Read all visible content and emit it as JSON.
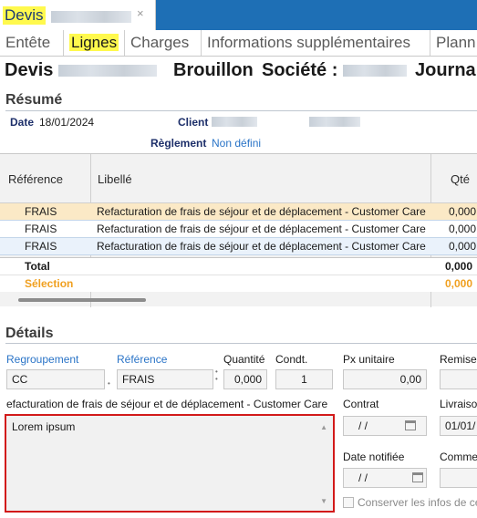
{
  "window": {
    "tab_title": "Devis",
    "close_glyph": "×"
  },
  "tabs": [
    {
      "label": "Entête"
    },
    {
      "label": "Lignes"
    },
    {
      "label": "Charges"
    },
    {
      "label": "Informations supplémentaires"
    },
    {
      "label": "Plann"
    }
  ],
  "header": {
    "prefix": "Devis",
    "status": "Brouillon",
    "societe_label": "Société :",
    "journal_label": "Journal"
  },
  "resume": {
    "title": "Résumé",
    "date_label": "Date",
    "date_value": "18/01/2024",
    "client_label": "Client",
    "reglement_label": "Règlement",
    "reglement_value": "Non défini"
  },
  "grid": {
    "columns": [
      "Référence",
      "Libellé",
      "Qté"
    ],
    "rows": [
      {
        "ref": "FRAIS",
        "libelle": "Refacturation de frais de séjour et de déplacement - Customer Care",
        "qty": "0,000"
      },
      {
        "ref": "FRAIS",
        "libelle": "Refacturation de frais de séjour et de déplacement - Customer Care",
        "qty": "0,000"
      },
      {
        "ref": "FRAIS",
        "libelle": "Refacturation de frais de séjour et de déplacement - Customer Care",
        "qty": "0,000"
      }
    ],
    "total_label": "Total",
    "total_value": "0,000",
    "selection_label": "Sélection",
    "selection_value": "0,000"
  },
  "details": {
    "title": "Détails",
    "regroupement_label": "Regroupement",
    "regroupement_value": "CC",
    "reference_label": "Référence",
    "reference_value": "FRAIS",
    "quantite_label": "Quantité",
    "quantite_value": "0,000",
    "condt_label": "Condt.",
    "condt_value": "1",
    "px_unitaire_label": "Px unitaire",
    "px_unitaire_value": "0,00",
    "remise_label": "Remise",
    "libelle_value": "efacturation de frais de séjour et de déplacement - Customer Care",
    "contrat_label": "Contrat",
    "contrat_value": "/ /",
    "livraison_label": "Livraison",
    "livraison_value": "01/01/",
    "date_notifiee_label": "Date notifiée",
    "date_notifiee_value": "/ /",
    "commentaire_label": "Comme",
    "conserver_label": "Conserver les infos de ce",
    "memo_value": "Lorem ipsum"
  },
  "colors": {
    "highlight": "#fff94d",
    "title_blue": "#1e6fb5",
    "label_navy": "#1d2f6a",
    "link_blue": "#2a74c7",
    "selection_orange": "#f0a020",
    "row_selected": "#fbe9c6",
    "row_alt": "#eaf2fb",
    "memo_border": "#d21a1a"
  }
}
